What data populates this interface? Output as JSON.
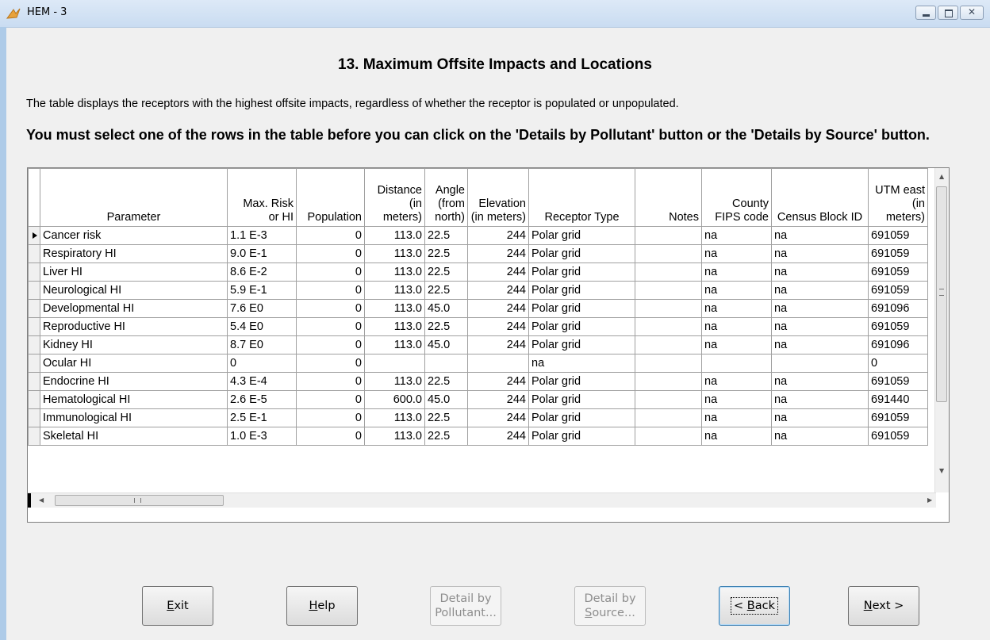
{
  "window": {
    "title": "HEM - 3"
  },
  "heading": "13. Maximum Offsite Impacts and Locations",
  "intro": "The table displays the receptors with the highest offsite impacts, regardless of whether the receptor is populated or unpopulated.",
  "warning": "You must select one of the rows in the table before you can click on the 'Details by Pollutant' button or the 'Details by Source' button.",
  "table": {
    "columns": [
      "Parameter",
      "Max. Risk or HI",
      "Population",
      "Distance (in meters)",
      "Angle (from north)",
      "Elevation (in meters)",
      "Receptor Type",
      "Notes",
      "County FIPS code",
      "Census Block ID",
      "UTM east (in meters)"
    ],
    "current_row": 0,
    "rows": [
      [
        "Cancer risk",
        "1.1 E-3",
        "0",
        "113.0",
        "22.5",
        "244",
        "Polar grid",
        "",
        "na",
        "na",
        "691059"
      ],
      [
        "Respiratory HI",
        "9.0 E-1",
        "0",
        "113.0",
        "22.5",
        "244",
        "Polar grid",
        "",
        "na",
        "na",
        "691059"
      ],
      [
        "Liver HI",
        "8.6 E-2",
        "0",
        "113.0",
        "22.5",
        "244",
        "Polar grid",
        "",
        "na",
        "na",
        "691059"
      ],
      [
        "Neurological HI",
        "5.9 E-1",
        "0",
        "113.0",
        "22.5",
        "244",
        "Polar grid",
        "",
        "na",
        "na",
        "691059"
      ],
      [
        "Developmental HI",
        "7.6 E0",
        "0",
        "113.0",
        "45.0",
        "244",
        "Polar grid",
        "",
        "na",
        "na",
        "691096"
      ],
      [
        "Reproductive HI",
        "5.4 E0",
        "0",
        "113.0",
        "22.5",
        "244",
        "Polar grid",
        "",
        "na",
        "na",
        "691059"
      ],
      [
        "Kidney HI",
        "8.7 E0",
        "0",
        "113.0",
        "45.0",
        "244",
        "Polar grid",
        "",
        "na",
        "na",
        "691096"
      ],
      [
        "Ocular HI",
        "0",
        "0",
        "",
        "",
        "",
        "na",
        "",
        "",
        "",
        "0"
      ],
      [
        "Endocrine HI",
        "4.3 E-4",
        "0",
        "113.0",
        "22.5",
        "244",
        "Polar grid",
        "",
        "na",
        "na",
        "691059"
      ],
      [
        "Hematological HI",
        "2.6 E-5",
        "0",
        "600.0",
        "45.0",
        "244",
        "Polar grid",
        "",
        "na",
        "na",
        "691440"
      ],
      [
        "Immunological HI",
        "2.5 E-1",
        "0",
        "113.0",
        "22.5",
        "244",
        "Polar grid",
        "",
        "na",
        "na",
        "691059"
      ],
      [
        "Skeletal HI",
        "1.0 E-3",
        "0",
        "113.0",
        "22.5",
        "244",
        "Polar grid",
        "",
        "na",
        "na",
        "691059"
      ]
    ]
  },
  "buttons": {
    "exit": {
      "label": "Exit",
      "accel": "E",
      "rest": "xit"
    },
    "help": {
      "label": "Help",
      "accel": "H",
      "rest": "elp"
    },
    "detail_pollutant": {
      "line1": "Detail by",
      "line2": "Pollutant..."
    },
    "detail_source": {
      "line1": "Detail by",
      "line2_accel": "S",
      "line2_rest": "ource..."
    },
    "back": {
      "pre": "< ",
      "accel": "B",
      "rest": "ack"
    },
    "next": {
      "accel": "N",
      "rest": "ext >"
    }
  }
}
